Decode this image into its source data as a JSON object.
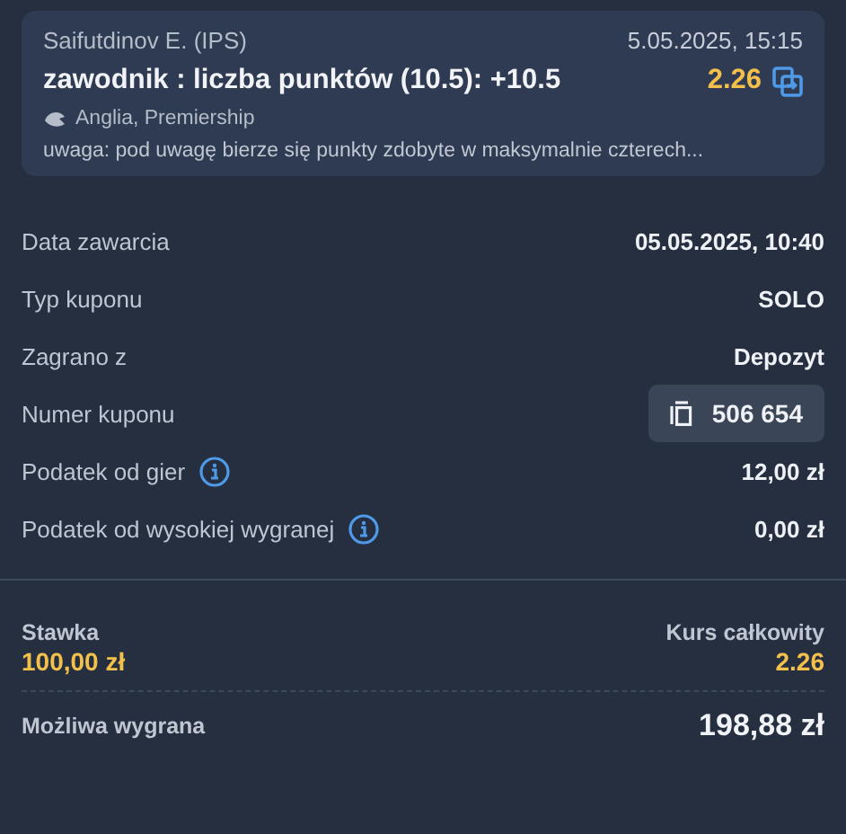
{
  "selection": {
    "player": "Saifutdinov E. (IPS)",
    "datetime": "5.05.2025, 15:15",
    "market": "zawodnik : liczba punktów (10.5): +10.5",
    "odds": "2.26",
    "league": "Anglia, Premiership",
    "note": "uwaga: pod uwagę bierze się punkty zdobyte w maksymalnie czterech..."
  },
  "details": [
    {
      "kind": "text",
      "label": "Data zawarcia",
      "value": "05.05.2025, 10:40"
    },
    {
      "kind": "text",
      "label": "Typ kuponu",
      "value": "SOLO"
    },
    {
      "kind": "text",
      "label": "Zagrano z",
      "value": "Depozyt"
    },
    {
      "kind": "copy",
      "label": "Numer kuponu",
      "value": "506 654"
    },
    {
      "kind": "info",
      "label": "Podatek od gier",
      "value": "12,00 zł"
    },
    {
      "kind": "info",
      "label": "Podatek od wysokiej wygranej",
      "value": "0,00 zł"
    }
  ],
  "summary": {
    "stake_label": "Stawka",
    "stake": "100,00 zł",
    "odds_label": "Kurs całkowity",
    "odds": "2.26",
    "win_label": "Możliwa wygrana",
    "win": "198,88 zł"
  }
}
